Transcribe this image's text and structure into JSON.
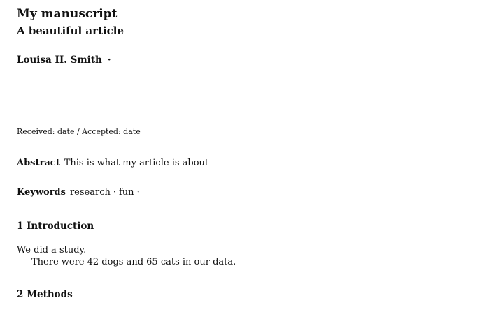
{
  "title": "My manuscript",
  "subtitle": "A beautiful article",
  "author": {
    "name": "Louisa H. Smith",
    "separator": "·"
  },
  "received_line": "Received: date / Accepted: date",
  "abstract": {
    "label": "Abstract",
    "text": "This is what my article is about"
  },
  "keywords": {
    "label": "Keywords",
    "items": [
      "research",
      "fun"
    ],
    "separator": "·"
  },
  "sections": [
    {
      "heading": "1 Introduction",
      "paragraphs": [
        "We did a study.",
        "There were 42 dogs and 65 cats in our data."
      ]
    },
    {
      "heading": "2 Methods"
    }
  ]
}
